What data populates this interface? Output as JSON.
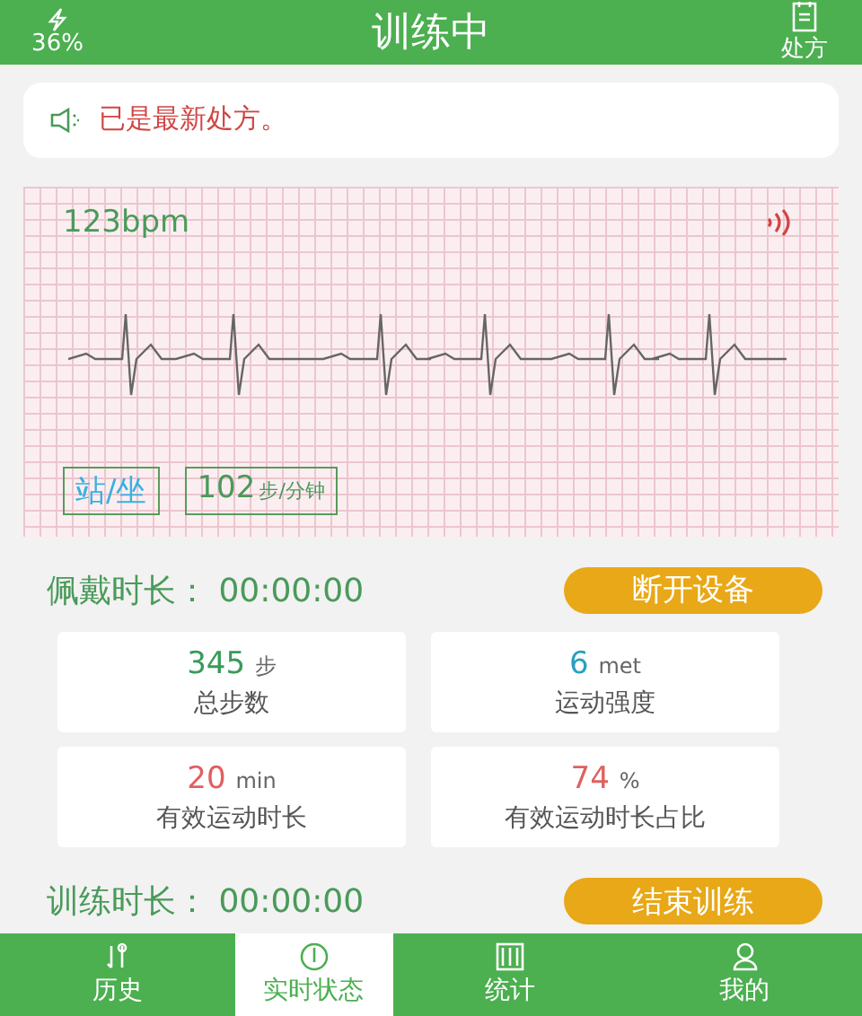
{
  "header": {
    "battery": "36%",
    "title": "训练中",
    "prescription": "处方"
  },
  "notice": "已是最新处方。",
  "ecg": {
    "heart_rate": "123bpm",
    "posture": "站/坐",
    "cadence": "102",
    "cadence_unit": "步/分钟",
    "sound_on": true
  },
  "wear": {
    "label": "佩戴时长：",
    "time": "00:00:00",
    "button": "断开设备"
  },
  "stats": [
    {
      "value": "345",
      "unit": "步",
      "label": "总步数",
      "color": "#3a9a5a"
    },
    {
      "value": "6",
      "unit": "met",
      "label": "运动强度",
      "color": "#2aa0c0"
    },
    {
      "value": "20",
      "unit": "min",
      "label": "有效运动时长",
      "color": "#e06060"
    },
    {
      "value": "74",
      "unit": "%",
      "label": "有效运动时长占比",
      "color": "#e06060"
    }
  ],
  "training": {
    "label": "训练时长：",
    "time": "00:00:00",
    "button": "结束训练"
  },
  "tabs": [
    {
      "label": "历史",
      "selected": false,
      "kind": "history"
    },
    {
      "label": "实时状态",
      "selected": true,
      "kind": "realtime"
    },
    {
      "label": "统计",
      "selected": false,
      "kind": "stats"
    },
    {
      "label": "我的",
      "selected": false,
      "kind": "me"
    }
  ]
}
